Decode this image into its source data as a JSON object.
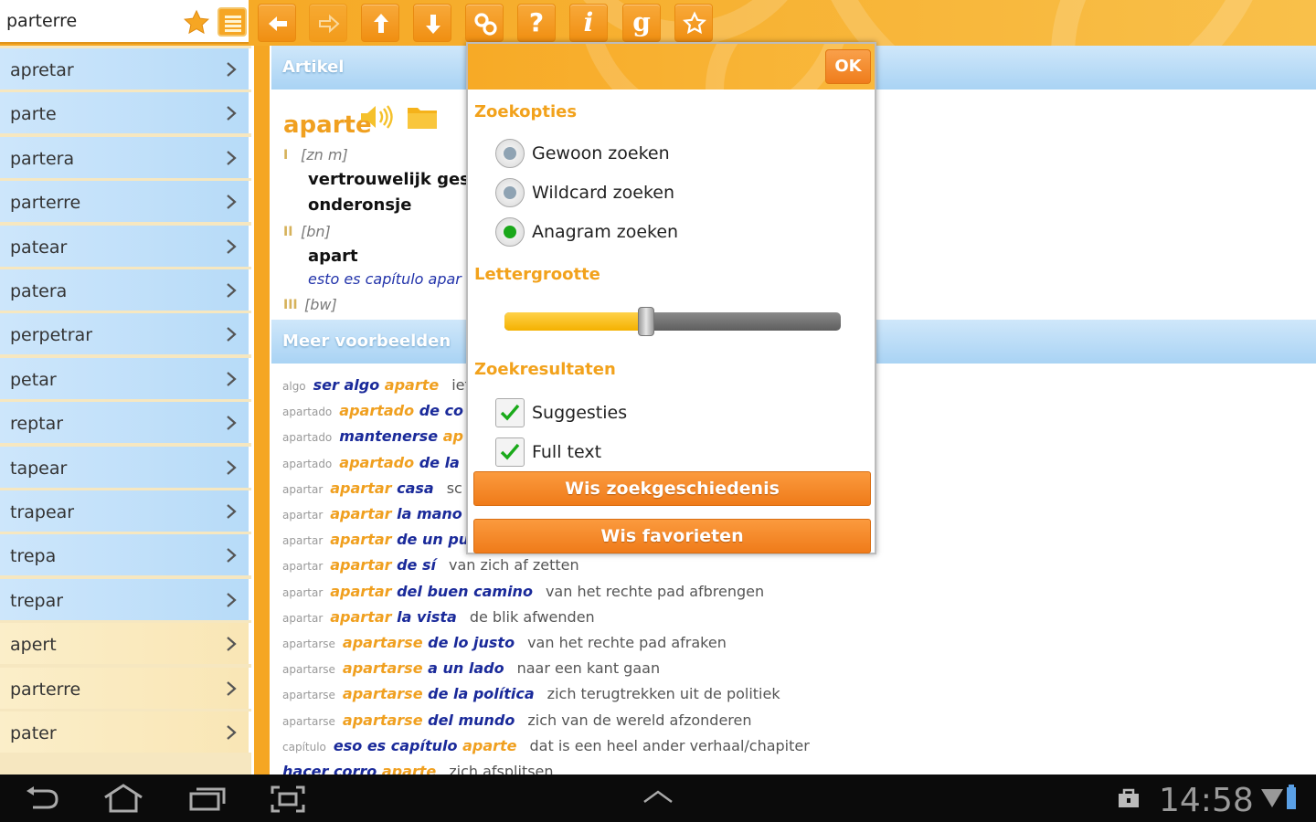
{
  "search": {
    "value": "parterre"
  },
  "toolbar": {
    "buttons": [
      {
        "name": "back-button",
        "icon": "arrow-left-icon"
      },
      {
        "name": "forward-button",
        "icon": "arrow-right-icon"
      },
      {
        "name": "up-button",
        "icon": "arrow-up-icon"
      },
      {
        "name": "down-button",
        "icon": "arrow-down-icon"
      },
      {
        "name": "settings-button",
        "icon": "link-icon"
      },
      {
        "name": "help-button",
        "icon": "question-icon",
        "glyph": "?"
      },
      {
        "name": "info-button",
        "icon": "info-icon",
        "glyph": "i"
      },
      {
        "name": "grammar-button",
        "icon": "grammar-icon",
        "glyph": "g"
      },
      {
        "name": "favorites-button",
        "icon": "star-icon"
      }
    ]
  },
  "word_list": {
    "blue_items": [
      "apretar",
      "parte",
      "partera",
      "parterre",
      "patear",
      "patera",
      "perpetrar",
      "petar",
      "reptar",
      "tapear",
      "trapear",
      "trepa",
      "trepar"
    ],
    "cream_items": [
      "apert",
      "parterre",
      "pater"
    ]
  },
  "article": {
    "section_title": "Artikel",
    "headword": "aparte",
    "entries": [
      {
        "roman": "I",
        "pos": "[zn m]",
        "lines": [
          "vertrouwelijk gesp",
          "onderonsje"
        ]
      },
      {
        "roman": "II",
        "pos": "[bn]",
        "lines": [
          "apart"
        ],
        "example": "esto es capítulo apar"
      },
      {
        "roman": "III",
        "pos": "[bw]"
      }
    ]
  },
  "examples": {
    "section_title": "Meer voorbeelden",
    "rows": [
      {
        "key": "algo",
        "parts": [
          [
            "b",
            "ser algo "
          ],
          [
            "o",
            "aparte"
          ]
        ],
        "translation": "iet"
      },
      {
        "key": "apartado",
        "parts": [
          [
            "o",
            "apartado "
          ],
          [
            "b",
            "de co"
          ]
        ],
        "translation": ""
      },
      {
        "key": "apartado",
        "parts": [
          [
            "b",
            "mantenerse "
          ],
          [
            "o",
            "ap"
          ]
        ],
        "translation": ""
      },
      {
        "key": "apartado",
        "parts": [
          [
            "o",
            "apartado "
          ],
          [
            "b",
            "de la"
          ]
        ],
        "translation": ""
      },
      {
        "key": "apartar",
        "parts": [
          [
            "o",
            "apartar "
          ],
          [
            "b",
            "casa"
          ]
        ],
        "translation": "sc"
      },
      {
        "key": "apartar",
        "parts": [
          [
            "o",
            "apartar "
          ],
          [
            "b",
            "la mano"
          ]
        ],
        "translation": ""
      },
      {
        "key": "apartar",
        "parts": [
          [
            "o",
            "apartar "
          ],
          [
            "b",
            "de un pu"
          ]
        ],
        "translation": ""
      },
      {
        "key": "apartar",
        "parts": [
          [
            "o",
            "apartar "
          ],
          [
            "b",
            "de sí"
          ]
        ],
        "translation": "van zich af zetten"
      },
      {
        "key": "apartar",
        "parts": [
          [
            "o",
            "apartar "
          ],
          [
            "b",
            "del buen camino"
          ]
        ],
        "translation": "van het rechte pad afbrengen"
      },
      {
        "key": "apartar",
        "parts": [
          [
            "o",
            "apartar "
          ],
          [
            "b",
            "la vista"
          ]
        ],
        "translation": "de blik afwenden"
      },
      {
        "key": "apartarse",
        "parts": [
          [
            "o",
            "apartarse "
          ],
          [
            "b",
            "de lo justo"
          ]
        ],
        "translation": "van het rechte pad afraken"
      },
      {
        "key": "apartarse",
        "parts": [
          [
            "o",
            "apartarse "
          ],
          [
            "b",
            "a un lado"
          ]
        ],
        "translation": "naar een kant gaan"
      },
      {
        "key": "apartarse",
        "parts": [
          [
            "o",
            "apartarse "
          ],
          [
            "b",
            "de la política"
          ]
        ],
        "translation": "zich terugtrekken uit de politiek"
      },
      {
        "key": "apartarse",
        "parts": [
          [
            "o",
            "apartarse "
          ],
          [
            "b",
            "del mundo"
          ]
        ],
        "translation": "zich van de wereld afzonderen"
      },
      {
        "key": "capítulo",
        "parts": [
          [
            "b",
            "eso es capítulo "
          ],
          [
            "o",
            "aparte"
          ]
        ],
        "translation": "dat is een heel ander verhaal/chapiter"
      },
      {
        "key": "",
        "parts": [
          [
            "b",
            "hacer corro "
          ],
          [
            "o",
            "aparte"
          ]
        ],
        "translation": "zich afsplitsen"
      }
    ]
  },
  "dialog": {
    "ok_label": "OK",
    "search_options_title": "Zoekopties",
    "search_options": [
      {
        "label": "Gewoon zoeken",
        "selected": false
      },
      {
        "label": "Wildcard zoeken",
        "selected": false
      },
      {
        "label": "Anagram zoeken",
        "selected": true
      }
    ],
    "font_size_title": "Lettergrootte",
    "font_size_level": 0.42,
    "results_title": "Zoekresultaten",
    "result_options": [
      {
        "label": "Suggesties",
        "checked": true
      },
      {
        "label": "Full text",
        "checked": true
      }
    ],
    "clear_history_label": "Wis zoekgeschiedenis",
    "clear_favorites_label": "Wis favorieten"
  },
  "statusbar": {
    "time": "14:58"
  },
  "colors": {
    "accent_orange": "#f5a623",
    "list_blue": "#b7dbf8",
    "list_cream": "#f9e6b5",
    "headword": "#f0a020"
  }
}
